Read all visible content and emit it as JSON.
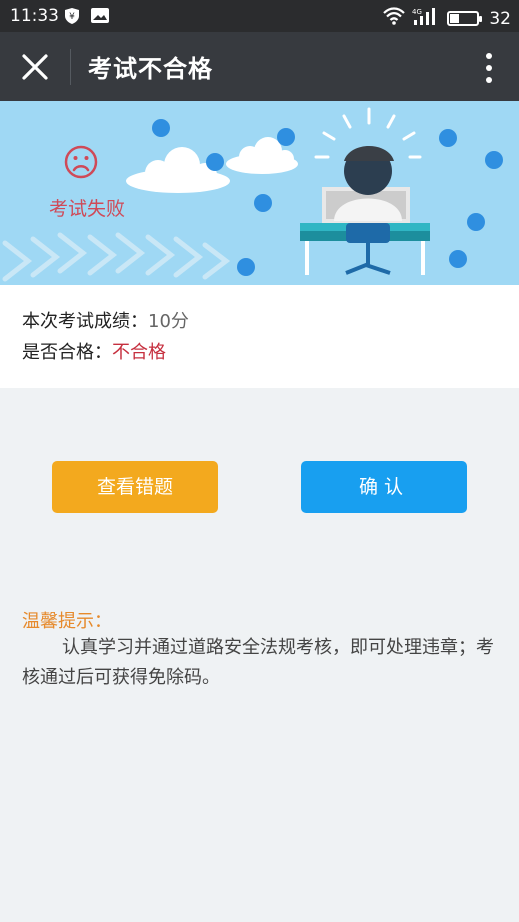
{
  "status_bar": {
    "time": "11:33",
    "battery": "32",
    "network": "4G"
  },
  "title_bar": {
    "title": "考试不合格"
  },
  "banner": {
    "fail_text": "考试失败"
  },
  "result": {
    "score_label": "本次考试成绩：",
    "score_value": "10分",
    "pass_label": "是否合格：",
    "pass_value": "不合格"
  },
  "buttons": {
    "review": "查看错题",
    "confirm": "确认"
  },
  "tips": {
    "title": "温馨提示：",
    "body": "认真学习并通过道路安全法规考核，即可处理违章；考核通过后可获得免除码。"
  },
  "colors": {
    "review_button": "#f3a91e",
    "confirm_button": "#189ff0",
    "fail_red": "#c6303f",
    "tip_orange": "#e68a2c"
  }
}
